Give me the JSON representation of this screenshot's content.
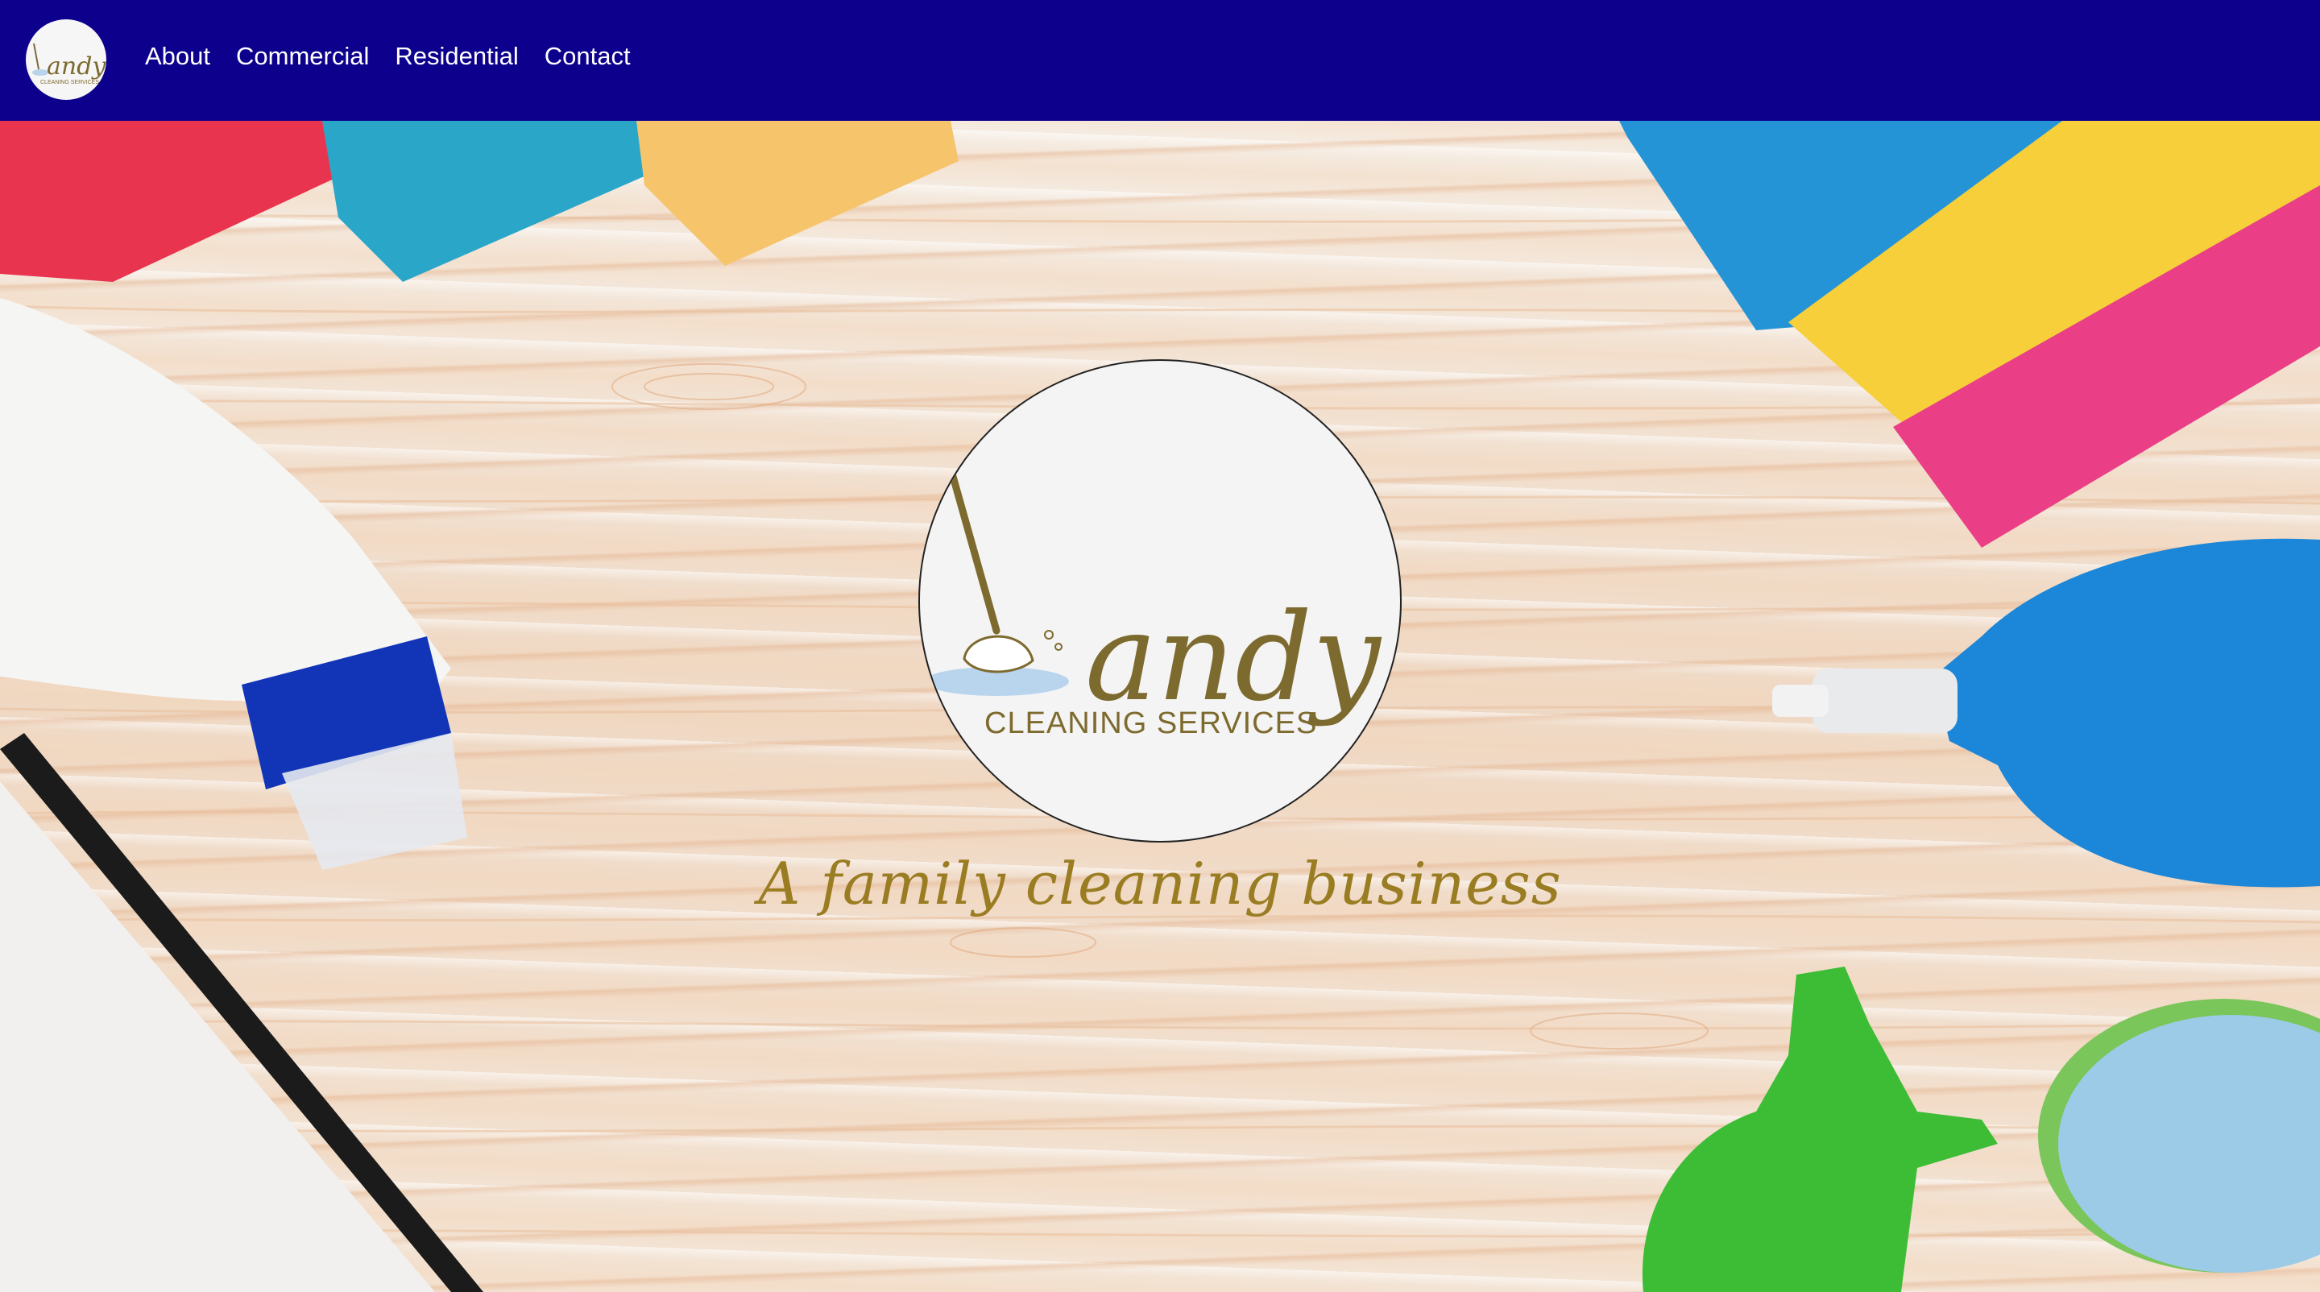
{
  "nav": {
    "logo_alt": "Candy Cleaning Services logo",
    "links": [
      "About",
      "Commercial",
      "Residential",
      "Contact"
    ]
  },
  "hero": {
    "logo": {
      "wordmark": "andy",
      "subtitle": "CLEANING SERVICES"
    },
    "tagline": "A family cleaning business"
  },
  "colors": {
    "navbar": "#0d008c",
    "tagline": "#9a7d22",
    "logo_text": "#7d6a2e"
  }
}
